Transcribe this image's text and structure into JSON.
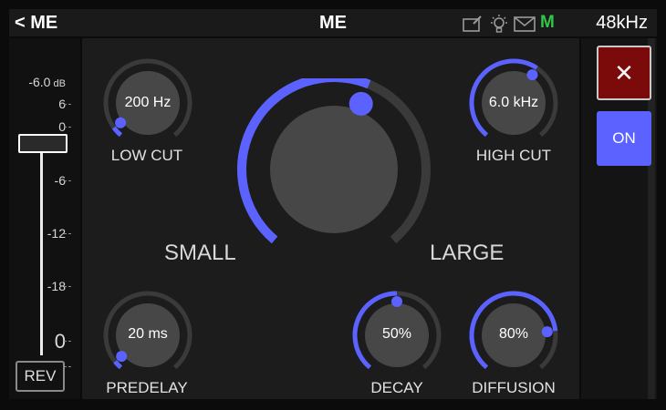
{
  "header": {
    "back_label": "< ME",
    "title": "ME",
    "sample_rate": "48kHz",
    "status_indicator": "M",
    "icons": [
      "window-edit-icon",
      "lightbulb-icon",
      "mail-icon"
    ]
  },
  "meter": {
    "peak_readout": "-6.0",
    "peak_unit": "dB",
    "scale": [
      "6",
      "0",
      "-6",
      "-12",
      "-18",
      "0"
    ],
    "fader_level_db": -6.0,
    "rev_label": "REV"
  },
  "knobs": {
    "low_cut": {
      "value": "200 Hz",
      "label": "LOW CUT",
      "fraction": 0.05
    },
    "high_cut": {
      "value": "6.0 kHz",
      "label": "HIGH CUT",
      "fraction": 0.62
    },
    "predelay": {
      "value": "20 ms",
      "label": "PREDELAY",
      "fraction": 0.04
    },
    "decay": {
      "value": "50%",
      "label": "DECAY",
      "fraction": 0.5
    },
    "diffusion": {
      "value": "80%",
      "label": "DIFFUSION",
      "fraction": 0.8
    }
  },
  "size_knob": {
    "small_label": "SMALL",
    "large_label": "LARGE",
    "fraction": 0.58
  },
  "buttons": {
    "close_symbol": "✕",
    "on_label": "ON"
  },
  "colors": {
    "accent": "#5b62ff",
    "track": "#3a3a3a",
    "knob": "#474747",
    "close_bg": "#7b0a0a",
    "indicator_green": "#31c54a"
  }
}
